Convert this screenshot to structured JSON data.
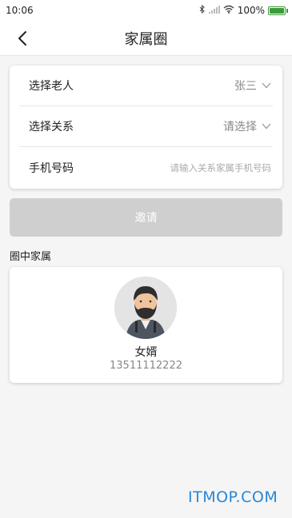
{
  "status_bar": {
    "time": "10:06",
    "battery": "100%",
    "icons": [
      "bluetooth-icon",
      "signal-icon",
      "wifi-icon",
      "battery-icon"
    ],
    "battery_color": "#3a9b3a"
  },
  "nav": {
    "title": "家属圈",
    "back_icon": "chevron-left-icon"
  },
  "form": {
    "elder": {
      "label": "选择老人",
      "value": "张三"
    },
    "relation": {
      "label": "选择关系",
      "value": "请选择"
    },
    "phone": {
      "label": "手机号码",
      "placeholder": "请输入关系家属手机号码",
      "value": ""
    }
  },
  "invite": {
    "label": "邀请",
    "enabled": false,
    "color": "#cfcfcf"
  },
  "members_section": {
    "title": "圈中家属",
    "members": [
      {
        "relation": "女婿",
        "phone": "13511112222",
        "avatar_icon": "man-avatar-icon"
      }
    ]
  },
  "watermark": {
    "text": "ITMOP.COM",
    "color": "#2a86d6"
  }
}
